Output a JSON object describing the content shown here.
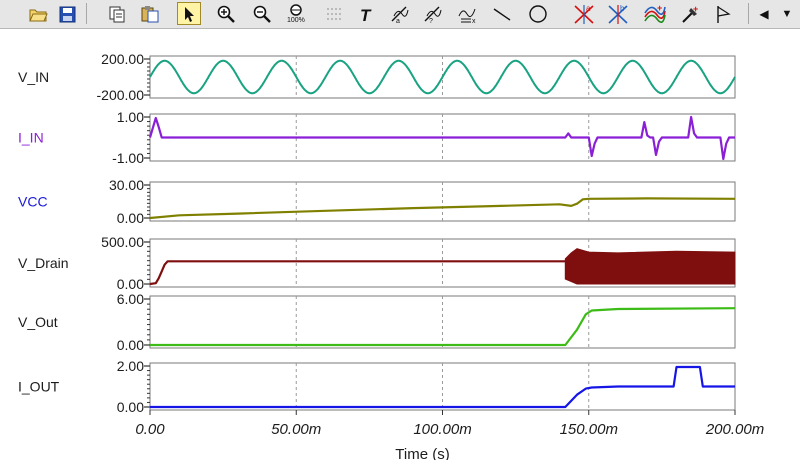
{
  "toolbar": {
    "buttons": [
      {
        "name": "open-folder-icon",
        "active": false
      },
      {
        "name": "save-disk-icon",
        "active": false
      },
      {
        "name": "copy-icon",
        "active": false
      },
      {
        "name": "paste-icon",
        "active": false
      },
      {
        "name": "select-pointer-icon",
        "active": true
      },
      {
        "name": "zoom-in-icon",
        "active": false
      },
      {
        "name": "zoom-out-icon",
        "active": false
      },
      {
        "name": "zoom-100-icon",
        "active": false
      },
      {
        "name": "grid-dots-icon",
        "active": false
      },
      {
        "name": "text-tool-icon",
        "active": false
      },
      {
        "name": "cursor-a-icon",
        "active": false
      },
      {
        "name": "cursor-b-icon",
        "active": false
      },
      {
        "name": "formula-icon",
        "active": false
      },
      {
        "name": "line-tool-icon",
        "active": false
      },
      {
        "name": "circle-tool-icon",
        "active": false
      },
      {
        "name": "marker-a-icon",
        "active": false
      },
      {
        "name": "marker-b-icon",
        "active": false
      },
      {
        "name": "add-curves-icon",
        "active": false
      },
      {
        "name": "color-picker-icon",
        "active": false
      },
      {
        "name": "flag-icon",
        "active": false
      }
    ],
    "zoom_100_label": "100%",
    "scroll_left_label": "◀",
    "scroll_right_label": "▼"
  },
  "colors": {
    "V_IN": "#1aa383",
    "I_IN": "#8a1fd6",
    "VCC": "#808000",
    "V_Drain": "#7f0f0f",
    "V_Out": "#3dbb17",
    "I_OUT": "#1515e6"
  },
  "chart_data": {
    "type": "line",
    "xlabel": "Time (s)",
    "x_tick_labels": [
      "0.00",
      "50.00m",
      "100.00m",
      "150.00m",
      "200.00m"
    ],
    "x_ticks": [
      0,
      50,
      100,
      150,
      200
    ],
    "xlim": [
      0,
      200
    ],
    "x_unit": "ms",
    "grid": true,
    "panels": [
      {
        "name": "V_IN",
        "label_color": "#1c1c1c",
        "ylim": [
          -200,
          200
        ],
        "y_tick_labels": [
          "200.00",
          "-200.00"
        ],
        "y_tick_values": [
          200,
          -200
        ],
        "series": [
          {
            "name": "V_IN",
            "kind": "sine",
            "amplitude": 180,
            "offset": 0,
            "period_ms": 20,
            "phase_deg": 0
          }
        ]
      },
      {
        "name": "I_IN",
        "label_color": "#8a1fd6",
        "ylim": [
          -1,
          1
        ],
        "y_tick_labels": [
          "1.00",
          "-1.00"
        ],
        "y_tick_values": [
          1,
          -1
        ],
        "series": [
          {
            "name": "I_IN",
            "kind": "line",
            "x": [
              0,
              2,
              3,
              4,
              142,
              143,
              144,
              150,
              151,
              152,
              153,
              168,
              169,
              170,
              171,
              171.5,
              172,
              173,
              174,
              175,
              184,
              185,
              186,
              187,
              188,
              189,
              190,
              195,
              196,
              197,
              198,
              200
            ],
            "y": [
              0,
              0.95,
              0.5,
              0,
              0,
              0.2,
              0,
              0,
              -0.9,
              -0.3,
              0,
              0,
              0.75,
              0.1,
              0,
              0,
              0,
              -0.85,
              -0.2,
              0,
              0,
              1.0,
              0.2,
              0,
              0,
              0,
              0,
              0,
              -1.05,
              -0.3,
              0,
              0
            ]
          }
        ]
      },
      {
        "name": "VCC",
        "label_color": "#1a1ad6",
        "ylim": [
          0,
          30
        ],
        "y_tick_labels": [
          "30.00",
          "0.00"
        ],
        "y_tick_values": [
          30,
          0
        ],
        "series": [
          {
            "name": "VCC",
            "kind": "line",
            "x": [
              0,
              10,
              30,
              60,
              90,
              120,
              140,
              144,
              146,
              148,
              150,
              170,
              200
            ],
            "y": [
              0,
              2.5,
              4,
              6.5,
              9,
              11,
              12.5,
              11,
              13,
              17,
              17.5,
              17.8,
              17.5
            ]
          }
        ]
      },
      {
        "name": "V_Drain",
        "label_color": "#1c1c1c",
        "ylim": [
          0,
          500
        ],
        "y_tick_labels": [
          "500.00",
          "0.00"
        ],
        "y_tick_values": [
          500,
          0
        ],
        "series": [
          {
            "name": "V_Drain",
            "kind": "line",
            "x": [
              0,
              2,
              3,
              4,
              5,
              6,
              142
            ],
            "y": [
              0,
              10,
              70,
              150,
              230,
              270,
              270
            ]
          },
          {
            "name": "V_Drain",
            "kind": "band",
            "x": [
              142,
              144,
              146,
              150,
              160,
              180,
              200
            ],
            "y_min": [
              60,
              30,
              0,
              0,
              0,
              0,
              0
            ],
            "y_max": [
              300,
              370,
              420,
              380,
              370,
              390,
              380
            ]
          }
        ]
      },
      {
        "name": "V_Out",
        "label_color": "#1c1c1c",
        "ylim": [
          0,
          6
        ],
        "y_tick_labels": [
          "6.00",
          "0.00"
        ],
        "y_tick_values": [
          6,
          0
        ],
        "series": [
          {
            "name": "V_Out",
            "kind": "line",
            "x": [
              0,
              142,
              146,
              149,
              151,
              160,
              200
            ],
            "y": [
              0,
              0,
              2.0,
              4.0,
              4.5,
              4.7,
              4.8
            ]
          }
        ]
      },
      {
        "name": "I_OUT",
        "label_color": "#1c1c1c",
        "ylim": [
          0,
          2
        ],
        "y_tick_labels": [
          "2.00",
          "0.00"
        ],
        "y_tick_values": [
          2,
          0
        ],
        "series": [
          {
            "name": "I_OUT",
            "kind": "line",
            "x": [
              0,
              142,
              146,
              149,
              151,
              160,
              179,
              180,
              188,
              189,
              200
            ],
            "y": [
              0,
              0,
              0.6,
              0.9,
              0.95,
              1.0,
              1.0,
              1.95,
              1.95,
              1.0,
              1.0
            ]
          }
        ]
      }
    ]
  }
}
